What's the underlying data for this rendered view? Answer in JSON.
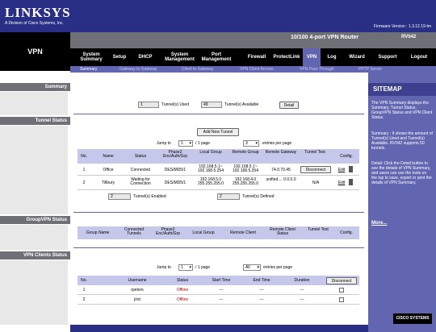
{
  "header": {
    "logo": "LINKSYS",
    "logo_sub": "A Division of Cisco Systems, Inc.",
    "firmware": "Firmware Version : 1.3.12.19-tm",
    "router_name": "10/100 4-port VPN Router",
    "model": "RV042",
    "section": "VPN"
  },
  "nav": [
    {
      "label": "System Summary"
    },
    {
      "label": "Setup"
    },
    {
      "label": "DHCP"
    },
    {
      "label": "System Management"
    },
    {
      "label": "Port Management"
    },
    {
      "label": "Firewall"
    },
    {
      "label": "ProtectLink"
    },
    {
      "label": "VPN"
    },
    {
      "label": "Log"
    },
    {
      "label": "Wizard"
    },
    {
      "label": "Support"
    },
    {
      "label": "Logout"
    }
  ],
  "subnav": [
    {
      "label": "Summary"
    },
    {
      "label": "Gateway to Gateway"
    },
    {
      "label": "Client to Gateway"
    },
    {
      "label": "VPN Client Access"
    },
    {
      "label": "VPN Pass Through"
    },
    {
      "label": "PPTP Server"
    }
  ],
  "left_labels": {
    "summary": "Summary",
    "tunnel_status": "Tunnel Status",
    "groupvpn_status": "GroupVPN Status",
    "vpn_clients_status": "VPN Clients Status"
  },
  "summary": {
    "tunnels_used": "1",
    "tunnels_used_label": "Tunnel(s) Used",
    "tunnels_available": "49",
    "tunnels_available_label": "Tunnel(s) Available",
    "detail_button": "Detail"
  },
  "tunnel_status": {
    "add_button": "Add New Tunnel",
    "jump_to": "Jump to",
    "page_value": "1",
    "page_suffix": "/ 1 page",
    "entries_value": "3",
    "entries_suffix": "entries per page",
    "columns": [
      "No.",
      "Name",
      "Status",
      "Phase2 Enc/Auth/Grp",
      "Local Group",
      "Remote Group",
      "Remote Gateway",
      "Tunnel Test",
      "Config."
    ],
    "rows": [
      {
        "no": "1",
        "name": "Office",
        "status": "Connected",
        "phase2": "DES/MD5/1",
        "local_group": "192.168.5.1~ 192.168.5.254",
        "remote_group": "192.168.5.1~ 192.168.5.254",
        "remote_gateway": "74.0.70.45",
        "test": "Disconnect",
        "edit": "Edit"
      },
      {
        "no": "2",
        "name": "Tillbury",
        "status": "Waiting for Connection",
        "phase2": "DES/MD5/1",
        "local_group": "192.168.5.0 255.255.255.0",
        "remote_group": "192.168.4.0 255.255.255.0",
        "remote_gateway": "unified.... 0.0.0.0",
        "test": "N/A",
        "edit": "Edit"
      }
    ],
    "enabled_count": "2",
    "enabled_label": "Tunnel(s) Enabled",
    "defined_count": "2",
    "defined_label": "Tunnel(s) Defined"
  },
  "groupvpn": {
    "columns": [
      "Group Name",
      "Connected Tunnels",
      "Phase2 Enc/Auth/Grp",
      "Local Group",
      "Remote Client",
      "Remote Client Status",
      "Tunnel Test",
      "Config."
    ]
  },
  "vpn_clients": {
    "jump_to": "Jump to",
    "page_value": "1",
    "page_suffix": "/ 1 page",
    "entries_value": "All",
    "entries_suffix": "entries per page",
    "columns": [
      "No.",
      "Username",
      "Status",
      "Start Time",
      "End Time",
      "Duration"
    ],
    "disconnect_button": "Disconnect",
    "rows": [
      {
        "no": "1",
        "username": "rpeters",
        "status": "Offline",
        "start": "---",
        "end": "---",
        "duration": "---"
      },
      {
        "no": "2",
        "username": "jrist",
        "status": "Offline",
        "start": "---",
        "end": "---",
        "duration": "---"
      }
    ]
  },
  "sitemap": {
    "title": "SITEMAP",
    "p1": "The VPN Summary displays the Summary, Tunnel Status, GroupVPN Status and VPN Client Status.",
    "p2": "Summary : It shows the amount of Tunnel(s) Used and Tunnel(s) Available. RV042 supports 50 tunnels.",
    "p3": "Detail: Click the Detail button to see the details of VPN Summary, and users can use the tools on the top to save, export or print the details of VPN Summary.",
    "more": "More..."
  },
  "footer": {
    "cisco": "CISCO SYSTEMS"
  },
  "colors": {
    "banner": "#2a2f86",
    "accent": "#6266b0",
    "offline": "#c00000"
  }
}
